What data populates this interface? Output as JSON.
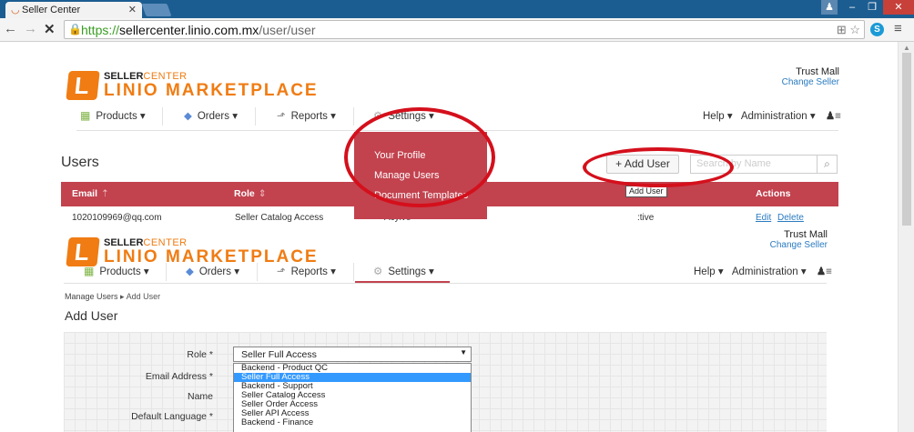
{
  "browser": {
    "tab_title": "Seller Center",
    "url_scheme": "https://",
    "url_host": "sellercenter.linio.com.mx",
    "url_path": "/user/user"
  },
  "brand": {
    "seller": "SELLER",
    "center": "CENTER",
    "marketplace": "LINIO MARKETPLACE",
    "accent_color": "#f07c13",
    "header_color": "#c2424e",
    "annotation_color": "#d4101c"
  },
  "shop": {
    "name": "Trust Mall",
    "change_label": "Change Seller"
  },
  "nav": {
    "products": "Products ▾",
    "orders": "Orders ▾",
    "reports": "Reports ▾",
    "settings": "Settings ▾",
    "help": "Help ▾",
    "administration": "Administration ▾"
  },
  "settings_menu": [
    "Your Profile",
    "Manage Users",
    "Document Templates"
  ],
  "users_page": {
    "title": "Users",
    "add_user_label": "Add User",
    "search_placeholder": "Search by Name",
    "tooltip": "Add User",
    "columns": [
      "Email",
      "Role",
      "Actions"
    ],
    "row": {
      "email": "1020109969@qq.com",
      "role": "Seller Catalog Access",
      "status_fragment": "Acyive",
      "active_fragment": ":tive",
      "edit": "Edit",
      "delete": "Delete"
    }
  },
  "add_user_page": {
    "breadcrumb_link": "Manage Users",
    "breadcrumb_current": "Add User",
    "title": "Add User",
    "labels": {
      "role": "Role *",
      "email": "Email Address *",
      "name": "Name",
      "language": "Default Language *"
    },
    "role_selected": "Seller Full Access",
    "role_options": [
      "Backend - Product QC",
      "Seller Full Access",
      "Backend - Support",
      "Seller Catalog Access",
      "Seller Order Access",
      "Seller API Access",
      "Backend - Finance"
    ]
  }
}
